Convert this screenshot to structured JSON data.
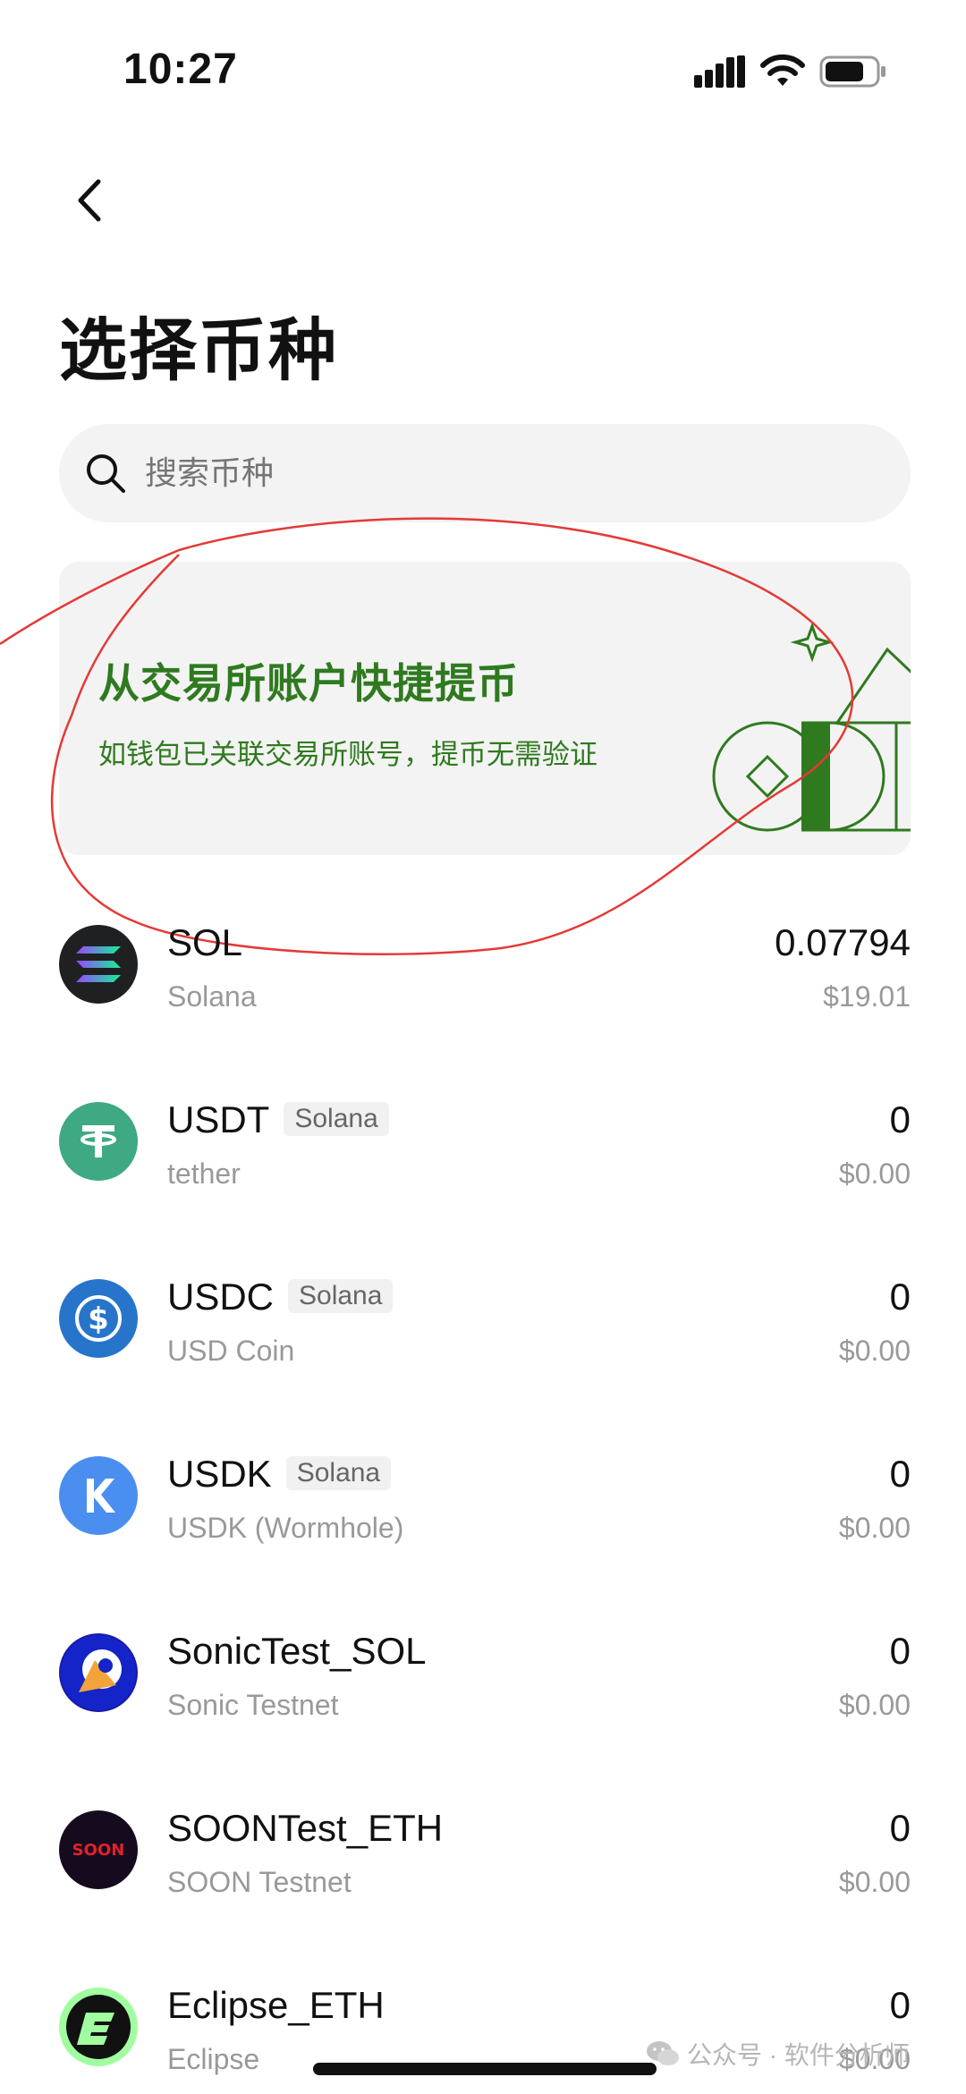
{
  "status_bar": {
    "time": "10:27"
  },
  "header": {
    "title": "选择币种"
  },
  "search": {
    "placeholder": "搜索币种"
  },
  "promo": {
    "title": "从交易所账户快捷提币",
    "subtitle": "如钱包已关联交易所账号，提币无需验证",
    "accent_color": "#2f7a1f"
  },
  "tokens": [
    {
      "symbol": "SOL",
      "name": "Solana",
      "chain": "",
      "amount": "0.07794",
      "value": "$19.01",
      "icon": "solana-icon"
    },
    {
      "symbol": "USDT",
      "name": "tether",
      "chain": "Solana",
      "amount": "0",
      "value": "$0.00",
      "icon": "tether-icon"
    },
    {
      "symbol": "USDC",
      "name": "USD Coin",
      "chain": "Solana",
      "amount": "0",
      "value": "$0.00",
      "icon": "usdc-icon"
    },
    {
      "symbol": "USDK",
      "name": "USDK (Wormhole)",
      "chain": "Solana",
      "amount": "0",
      "value": "$0.00",
      "icon": "usdk-icon"
    },
    {
      "symbol": "SonicTest_SOL",
      "name": "Sonic Testnet",
      "chain": "",
      "amount": "0",
      "value": "$0.00",
      "icon": "sonic-icon"
    },
    {
      "symbol": "SOONTest_ETH",
      "name": "SOON Testnet",
      "chain": "",
      "amount": "0",
      "value": "$0.00",
      "icon": "soon-icon",
      "logo_text": "SOON"
    },
    {
      "symbol": "Eclipse_ETH",
      "name": "Eclipse",
      "chain": "",
      "amount": "0",
      "value": "$0.00",
      "icon": "eclipse-icon"
    }
  ],
  "watermark": {
    "text": "公众号 · 软件分析师"
  }
}
